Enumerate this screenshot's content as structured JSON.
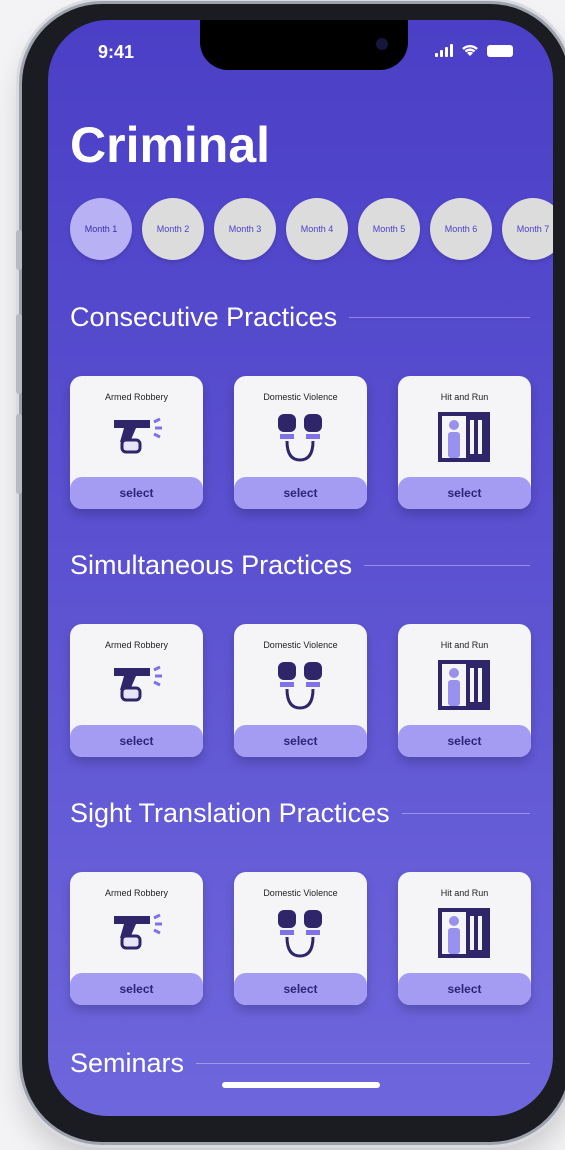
{
  "status_bar": {
    "time": "9:41"
  },
  "header": {
    "title": "Criminal"
  },
  "months": [
    "Month 1",
    "Month 2",
    "Month 3",
    "Month 4",
    "Month 5",
    "Month 6",
    "Month 7"
  ],
  "sections": [
    {
      "title": "Consecutive Practices",
      "cards": [
        {
          "title": "Armed Robbery",
          "icon": "gun-icon",
          "select_label": "select"
        },
        {
          "title": "Domestic Violence",
          "icon": "handcuffed-hands-icon",
          "select_label": "select"
        },
        {
          "title": "Hit and Run",
          "icon": "prison-person-icon",
          "select_label": "select"
        }
      ]
    },
    {
      "title": "Simultaneous Practices",
      "cards": [
        {
          "title": "Armed Robbery",
          "icon": "gun-icon",
          "select_label": "select"
        },
        {
          "title": "Domestic Violence",
          "icon": "handcuffed-hands-icon",
          "select_label": "select"
        },
        {
          "title": "Hit and Run",
          "icon": "prison-person-icon",
          "select_label": "select"
        }
      ]
    },
    {
      "title": "Sight Translation Practices",
      "cards": [
        {
          "title": "Armed Robbery",
          "icon": "gun-icon",
          "select_label": "select"
        },
        {
          "title": "Domestic Violence",
          "icon": "handcuffed-hands-icon",
          "select_label": "select"
        },
        {
          "title": "Hit and Run",
          "icon": "prison-person-icon",
          "select_label": "select"
        }
      ]
    },
    {
      "title": "Seminars",
      "cards": []
    }
  ],
  "colors": {
    "background_top": "#4a3fc6",
    "background_bottom": "#6e66dc",
    "accent": "#a49cf3"
  }
}
